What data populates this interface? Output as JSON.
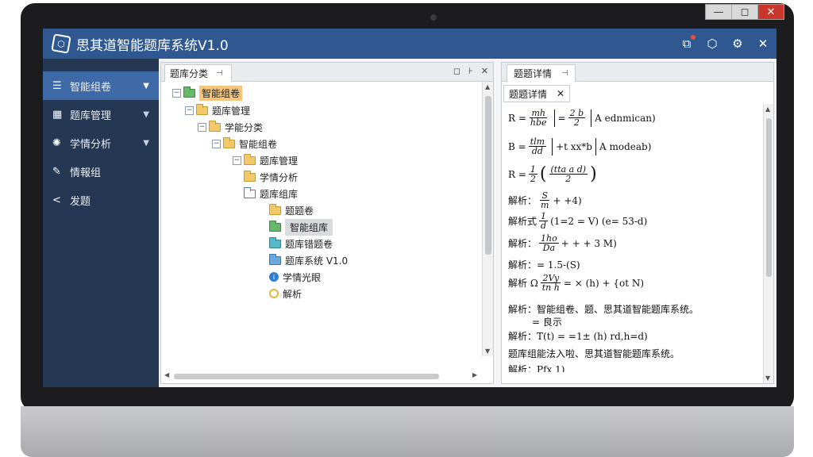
{
  "window": {
    "min": "—",
    "max": "◻",
    "close": "✕"
  },
  "app": {
    "title": "思其道智能题库系统V1.0",
    "logo_icon": "hexagon-logo-icon"
  },
  "titlebar": {
    "icons": [
      "export-icon",
      "hexagon-icon",
      "gear-icon",
      "close-icon"
    ]
  },
  "sidebar": {
    "items": [
      {
        "label": "智能组卷",
        "icon": "list-icon"
      },
      {
        "label": "题库管理",
        "icon": "grid-icon"
      },
      {
        "label": "学情分析",
        "icon": "bulb-icon"
      },
      {
        "label": "情報组",
        "icon": "pen-icon"
      },
      {
        "label": "发题",
        "icon": "back-icon"
      }
    ]
  },
  "left_panel": {
    "tab_label": "题库分类",
    "tree": [
      {
        "label": "智能组卷",
        "highlight": "orange"
      },
      {
        "label": "题库管理"
      },
      {
        "label": "学能分类"
      },
      {
        "label": "智能组卷"
      },
      {
        "label": "题库管理"
      },
      {
        "label": "学情分析"
      },
      {
        "label": "题库组库"
      },
      {
        "label": "题题卷"
      },
      {
        "label": "智能组库",
        "highlight": "gray"
      },
      {
        "label": "题库错题卷"
      },
      {
        "label": "题库系统 V1.0"
      },
      {
        "label": "学情光眼"
      },
      {
        "label": "解析"
      }
    ]
  },
  "right_panel": {
    "tab_label": "题题详情",
    "subtab_label": "题题详情",
    "lines": {
      "l1_prefix": "R =",
      "l1_num1": "mh",
      "l1_den1": "hbe",
      "l1_mid": "=",
      "l1_num2": "2 b",
      "l1_den2": "2",
      "l1_suffix": "A ednmican)",
      "l2_prefix": "B =",
      "l2_num": "tlm",
      "l2_den": "dd",
      "l2_mid": "+t  xx*b",
      "l2_suffix": "A modeab)",
      "l3_prefix": "R =",
      "l3_num": "1",
      "l3_den": "2",
      "l3_inner_num": "(tta  a  d)",
      "l3_inner_den": "2",
      "l4_label": "解析：",
      "l4_num": "S",
      "l4_den": "m",
      "l4_tail": "+ +4)",
      "l5_label": "解析式",
      "l5_num": "1",
      "l5_den": "d",
      "l5_tail": "(1=2 = V)  (e= 53-d)",
      "l6_label": "解析：",
      "l6_num": "1ho",
      "l6_den": "Da",
      "l6_tail": "+ + + 3 M)",
      "l7_label": "解析：",
      "l7_tail": "=  1.5-(S)",
      "l8_label": "解析 Ω",
      "l8_num": "2Vy",
      "l8_den": "tn h",
      "l8_tail": "= ×  (h) + {ot N)",
      "l9_label": "解析：",
      "l9_text": "智能组卷、题、思其道智能题库系统。",
      "l9_sub": "= 良示",
      "l10_label": "解析：",
      "l10_text": "T(t) = =1± (h) rd,h=d)",
      "l11_text": "题库组能法入啦、思其道智能题库系统。",
      "l12_label": "解析：",
      "l12_text": "Pfx 1)"
    }
  }
}
